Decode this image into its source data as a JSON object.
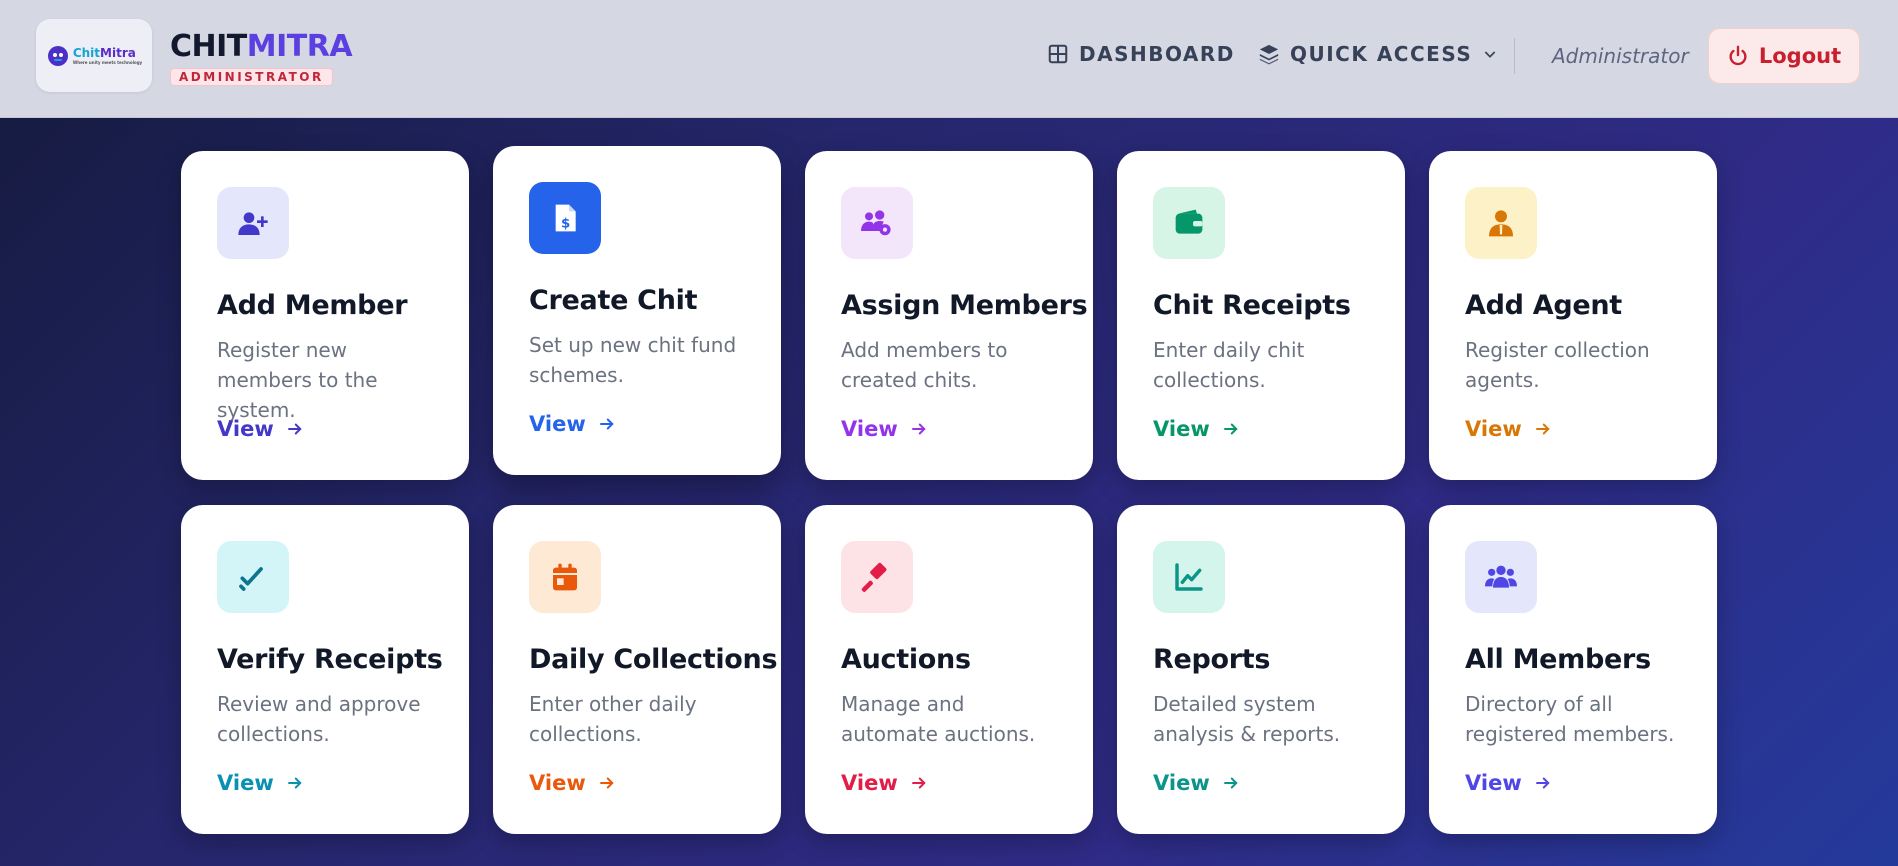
{
  "header": {
    "logo": {
      "text_part1": "Chit",
      "text_part2": "Mitra",
      "tagline": "Where unity meets technology"
    },
    "brand": {
      "name_part1": "CHIT",
      "name_part2": "MITRA",
      "role_badge": "ADMINISTRATOR"
    },
    "nav": {
      "dashboard": "DASHBOARD",
      "quick_access": "QUICK ACCESS"
    },
    "user_name": "Administrator",
    "logout_label": "Logout"
  },
  "cards": [
    {
      "title": "Add Member",
      "description": "Register new members to the system.",
      "link": "View",
      "icon": "user-plus-icon",
      "accent": "#4338ca",
      "icon_bg": "#e4e6fb"
    },
    {
      "title": "Create Chit",
      "description": "Set up new chit fund schemes.",
      "link": "View",
      "icon": "dollar-document-icon",
      "accent": "#2563eb",
      "icon_bg": "#2563eb"
    },
    {
      "title": "Assign Members",
      "description": "Add members to created chits.",
      "link": "View",
      "icon": "users-cog-icon",
      "accent": "#9333ea",
      "icon_bg": "#f3e6fb"
    },
    {
      "title": "Chit Receipts",
      "description": "Enter daily chit collections.",
      "link": "View",
      "icon": "wallet-icon",
      "accent": "#059669",
      "icon_bg": "#d6f5e6"
    },
    {
      "title": "Add Agent",
      "description": "Register collection agents.",
      "link": "View",
      "icon": "agent-icon",
      "accent": "#d97706",
      "icon_bg": "#fdf1c7"
    },
    {
      "title": "Verify Receipts",
      "description": "Review and approve collections.",
      "link": "View",
      "icon": "double-check-icon",
      "accent": "#0891b2",
      "icon_bg": "#d3f5f8"
    },
    {
      "title": "Daily Collections",
      "description": "Enter other daily collections.",
      "link": "View",
      "icon": "calendar-icon",
      "accent": "#ea580c",
      "icon_bg": "#fde9d4"
    },
    {
      "title": "Auctions",
      "description": "Manage and automate auctions.",
      "link": "View",
      "icon": "gavel-icon",
      "accent": "#e11d48",
      "icon_bg": "#fde3e6"
    },
    {
      "title": "Reports",
      "description": "Detailed system analysis & reports.",
      "link": "View",
      "icon": "line-chart-icon",
      "accent": "#0d9488",
      "icon_bg": "#d4f5ec"
    },
    {
      "title": "All Members",
      "description": "Directory of all registered members.",
      "link": "View",
      "icon": "users-icon",
      "accent": "#4f46e5",
      "icon_bg": "#e4e6fb"
    }
  ]
}
